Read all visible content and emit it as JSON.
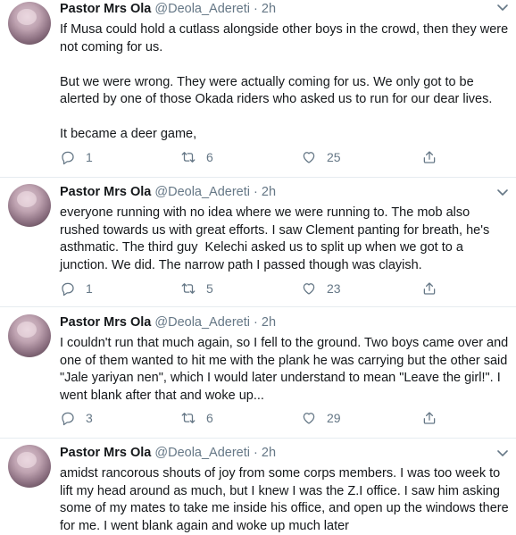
{
  "tweets": [
    {
      "name": "Pastor Mrs Ola",
      "handle": "@Deola_Adereti",
      "dot": "·",
      "time": "2h",
      "text": "If Musa could hold a cutlass alongside other boys in the crowd, then they were not coming for us.\n\nBut we were wrong. They were actually coming for us. We only got to be alerted by one of those Okada riders who asked us to run for our dear lives.\n\nIt became a deer game,",
      "replies": "1",
      "retweets": "6",
      "likes": "25"
    },
    {
      "name": "Pastor Mrs Ola",
      "handle": "@Deola_Adereti",
      "dot": "·",
      "time": "2h",
      "text": "everyone running with no idea where we were running to. The mob also rushed towards us with great efforts. I saw Clement panting for breath, he's asthmatic. The third guy  Kelechi asked us to split up when we got to a junction. We did. The narrow path I passed though was clayish.",
      "replies": "1",
      "retweets": "5",
      "likes": "23"
    },
    {
      "name": "Pastor Mrs Ola",
      "handle": "@Deola_Adereti",
      "dot": "·",
      "time": "2h",
      "text": "I couldn't run that much again, so I fell to the ground. Two boys came over and one of them wanted to hit me with the plank he was carrying but the other said \"Jale yariyan nen\", which I would later understand to mean \"Leave the girl!\". I went blank after that and woke up...",
      "replies": "3",
      "retweets": "6",
      "likes": "29"
    },
    {
      "name": "Pastor Mrs Ola",
      "handle": "@Deola_Adereti",
      "dot": "·",
      "time": "2h",
      "text": "amidst rancorous shouts of joy from some corps members. I was too week to lift my head around as much, but I knew I was the Z.I office. I saw him asking some of my mates to take me inside his office, and open up the windows there for me. I went blank again and woke up much later",
      "replies": "",
      "retweets": "",
      "likes": ""
    }
  ]
}
